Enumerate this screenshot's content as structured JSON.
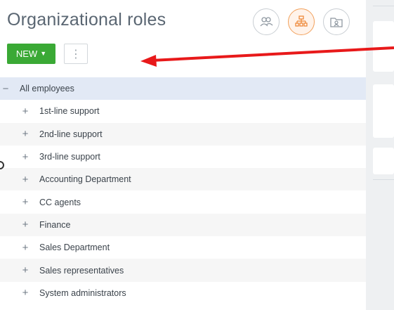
{
  "page_title": "Organizational roles",
  "toolbar": {
    "new_label": "NEW",
    "more_label": "⋮"
  },
  "view_buttons": [
    {
      "icon": "people-icon",
      "active": false
    },
    {
      "icon": "org-structure-icon",
      "active": true
    },
    {
      "icon": "folder-user-icon",
      "active": false
    }
  ],
  "tree": {
    "root": {
      "label": "All employees",
      "toggle": "−"
    },
    "children": [
      {
        "label": "1st-line support",
        "toggle": "+"
      },
      {
        "label": "2nd-line support",
        "toggle": "+"
      },
      {
        "label": "3rd-line support",
        "toggle": "+"
      },
      {
        "label": "Accounting Department",
        "toggle": "+"
      },
      {
        "label": "CC agents",
        "toggle": "+"
      },
      {
        "label": "Finance",
        "toggle": "+"
      },
      {
        "label": "Sales Department",
        "toggle": "+"
      },
      {
        "label": "Sales representatives",
        "toggle": "+"
      },
      {
        "label": "System administrators",
        "toggle": "+"
      }
    ]
  },
  "colors": {
    "new_button": "#3aa935",
    "root_row": "#e2e9f5",
    "active_view": "#f2a15c",
    "annotation_arrow": "#e8191a"
  }
}
